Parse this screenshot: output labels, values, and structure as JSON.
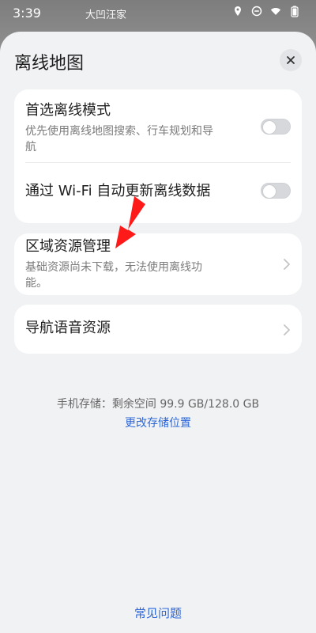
{
  "statusbar": {
    "time": "3:39",
    "place": "大凹汪家",
    "icons": [
      "location-icon",
      "do-not-disturb-icon",
      "wifi-icon",
      "battery-icon"
    ]
  },
  "sheet": {
    "title": "离线地图"
  },
  "settings": {
    "preferred_offline_mode_title": "首选离线模式",
    "preferred_offline_mode_desc_line1": "优先使用离线地图搜索、行车规划和导",
    "preferred_offline_mode_desc_line2": "航",
    "wifi_auto_update_title": "通过 Wi-Fi 自动更新离线数据",
    "preferred_offline_mode_enabled": false,
    "wifi_auto_update_enabled": false
  },
  "region_resources": {
    "title": "区域资源管理",
    "desc_line1": "基础资源尚未下载，无法使用离线功",
    "desc_line2": "能。"
  },
  "voice_resources": {
    "title": "导航语音资源"
  },
  "storage": {
    "text": "手机存储：剩余空间 99.9 GB/128.0 GB",
    "change_location": "更改存储位置"
  },
  "footer": {
    "faq": "常见问题"
  },
  "colors": {
    "accent": "#2b66d8",
    "sheet_bg": "#f1f2f4",
    "card_bg": "#ffffff",
    "arrow": "#ff1a1a"
  }
}
